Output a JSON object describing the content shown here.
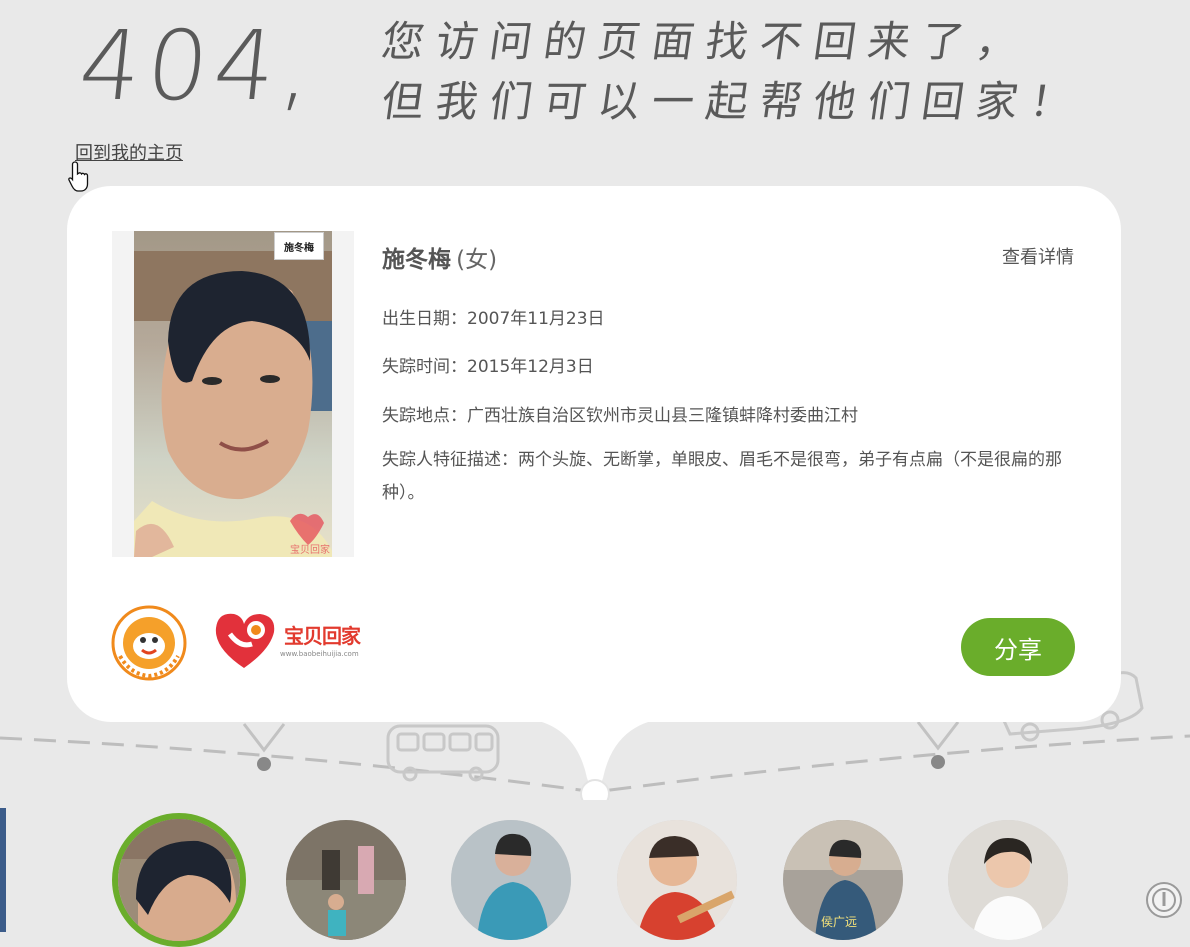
{
  "header": {
    "code": "404,",
    "line1": "您访问的页面找不回来了，",
    "line2": "但我们可以一起帮他们回家！",
    "home_link": "回到我的主页"
  },
  "card": {
    "photo_tag": "施冬梅",
    "name": "施冬梅",
    "gender": "(女)",
    "detail_link": "查看详情",
    "birth": "出生日期：2007年11月23日",
    "missing_time": "失踪时间：2015年12月3日",
    "missing_place": "失踪地点：广西壮族自治区钦州市灵山县三隆镇蚌降村委曲江村",
    "features": "失踪人特征描述：两个头旋、无断掌，单眼皮、眉毛不是很弯，弟子有点扁（不是很扁的那种）。",
    "logos": {
      "volunteer_icon": "tencent-volunteer-logo",
      "baobei_brand": "宝贝回家",
      "baobei_url": "www.baobeihuijia.com"
    },
    "share_button": "分享"
  },
  "thumbnails": [
    {
      "name": "thumb-1",
      "active": true,
      "caption": ""
    },
    {
      "name": "thumb-2",
      "active": false,
      "caption": ""
    },
    {
      "name": "thumb-3",
      "active": false,
      "caption": ""
    },
    {
      "name": "thumb-4",
      "active": false,
      "caption": ""
    },
    {
      "name": "thumb-5",
      "active": false,
      "caption": "侯广远"
    },
    {
      "name": "thumb-6",
      "active": false,
      "caption": ""
    }
  ],
  "colors": {
    "background": "#e9e9e9",
    "accent_green": "#6aad2b",
    "text": "#555555",
    "card": "#ffffff"
  }
}
